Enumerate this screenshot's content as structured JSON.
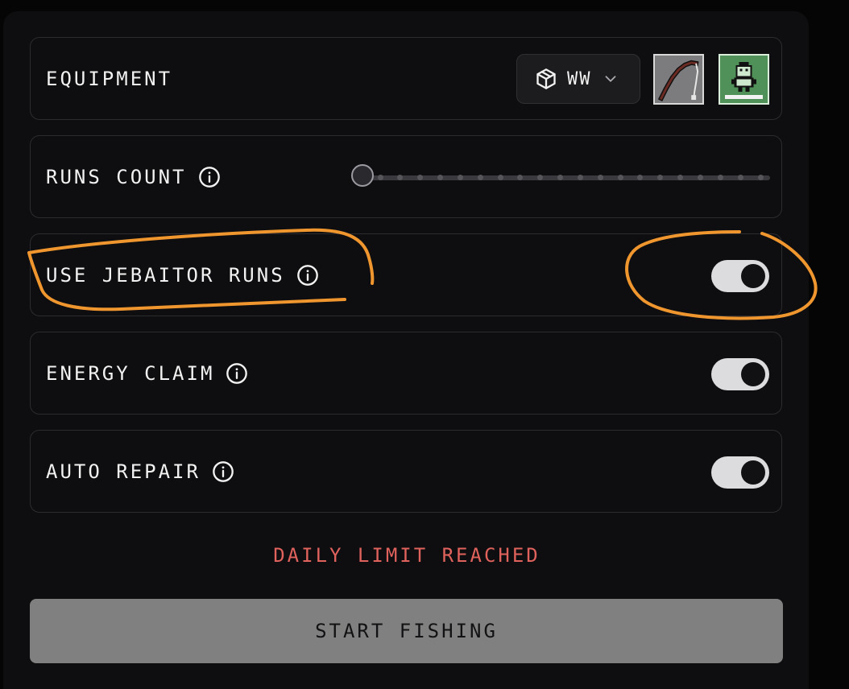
{
  "rows": {
    "equipment": {
      "label": "EQUIPMENT",
      "select_value": "WW",
      "select_icon": "package-icon",
      "dropdown_icon": "chevron-down-icon",
      "items": [
        {
          "name": "fishing-rod",
          "icon": "fishing-rod-icon"
        },
        {
          "name": "character-avatar",
          "icon": "pixel-character-icon"
        }
      ]
    },
    "runs_count": {
      "label": "RUNS COUNT",
      "slider_steps": 20,
      "slider_value": 0
    },
    "use_jebaitor_runs": {
      "label": "USE JEBAITOR RUNS",
      "enabled": true
    },
    "energy_claim": {
      "label": "ENERGY CLAIM",
      "enabled": true
    },
    "auto_repair": {
      "label": "AUTO REPAIR",
      "enabled": true
    }
  },
  "status": {
    "limit_message": "DAILY LIMIT REACHED"
  },
  "actions": {
    "start_label": "START FISHING"
  },
  "colors": {
    "background": "#0e0e10",
    "row_border": "#2c2c30",
    "text": "#f2f2f2",
    "warning": "#e0625c",
    "toggle_on": "#dcdcdf",
    "start_button": "#808080",
    "annotation_stroke": "#f0962e"
  },
  "annotations": [
    {
      "target": "use-jebaitor-runs-label",
      "shape": "hand-drawn-circle"
    },
    {
      "target": "use-jebaitor-runs-toggle",
      "shape": "hand-drawn-circle"
    }
  ]
}
